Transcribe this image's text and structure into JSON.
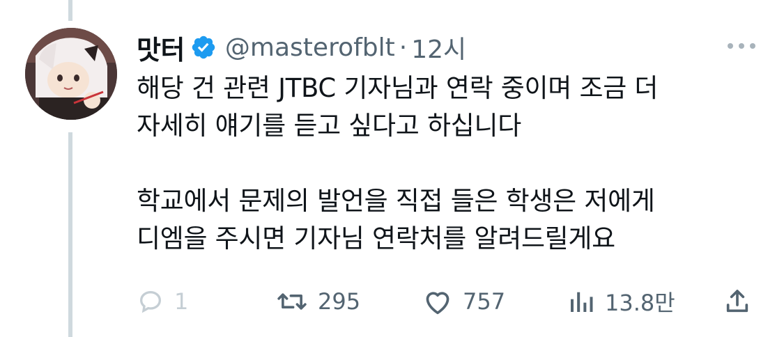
{
  "tweet": {
    "display_name": "맛터",
    "handle": "@masterofblt",
    "separator": "·",
    "time": "12시",
    "text_line1": "해당 건 관련 JTBC 기자님과 연락 중이며 조금 더",
    "text_line2": "자세히 얘기를 듣고 싶다고 하십니다",
    "text_line3": "학교에서 문제의 발언을 직접 들은 학생은 저에게",
    "text_line4": "디엠을 주시면 기자님 연락처를 알려드릴게요",
    "verified_color": "#1d9bf0"
  },
  "actions": {
    "reply_count": "1",
    "retweet_count": "295",
    "like_count": "757",
    "views_count": "13.8만"
  },
  "icons": {
    "verified": "verified-badge-icon",
    "more": "more-options-icon",
    "reply": "reply-icon",
    "retweet": "retweet-icon",
    "like": "heart-icon",
    "views": "views-chart-icon",
    "share": "share-icon"
  }
}
